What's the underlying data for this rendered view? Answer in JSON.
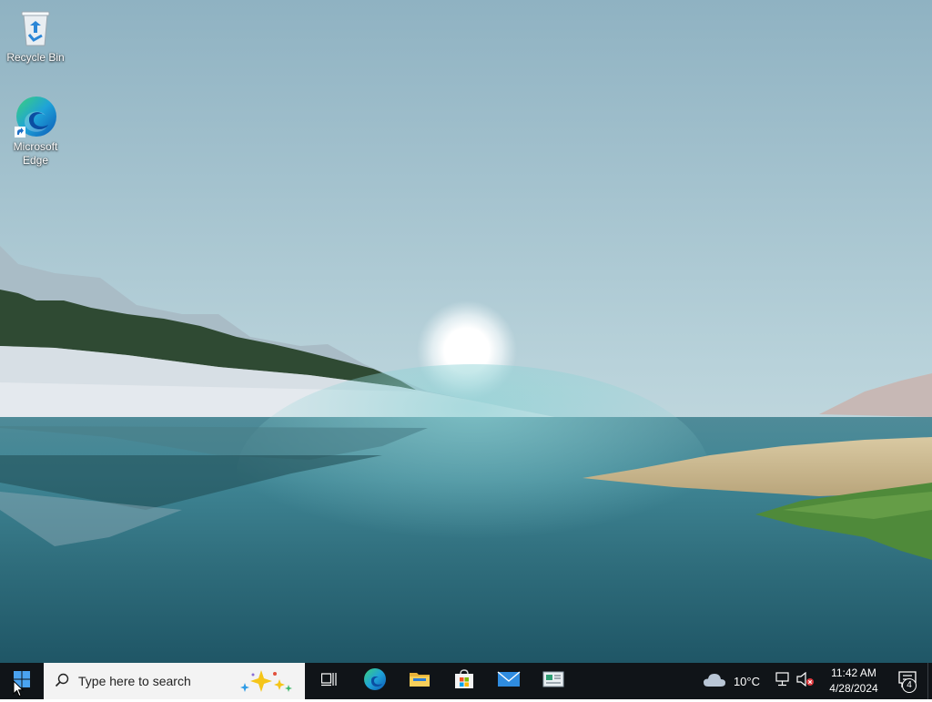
{
  "desktop": {
    "icons": [
      {
        "label": "Recycle Bin",
        "icon": "recycle-bin-icon"
      },
      {
        "label": "Microsoft Edge",
        "icon": "edge-icon"
      }
    ]
  },
  "taskbar": {
    "start_icon": "windows-logo-icon",
    "search": {
      "placeholder": "Type here to search",
      "icon": "search-icon"
    },
    "task_view_icon": "task-view-icon",
    "pinned_apps": [
      {
        "name": "Microsoft Edge",
        "icon": "edge-icon"
      },
      {
        "name": "File Explorer",
        "icon": "folder-icon"
      },
      {
        "name": "Microsoft Store",
        "icon": "store-icon"
      },
      {
        "name": "Mail",
        "icon": "mail-icon"
      },
      {
        "name": "News",
        "icon": "news-icon"
      }
    ],
    "weather": {
      "temp": "10°C",
      "icon": "cloud-icon"
    },
    "tray": {
      "network_icon": "network-icon",
      "volume_icon": "volume-muted-icon"
    },
    "clock": {
      "time": "11:42 AM",
      "date": "4/28/2024"
    },
    "notifications": {
      "count": "4",
      "icon": "notification-icon"
    }
  },
  "colors": {
    "taskbar_bg": "#101418",
    "search_bg": "#f3f3f3",
    "sky_top": "#8fb3c4",
    "water": "#2f6f80"
  }
}
